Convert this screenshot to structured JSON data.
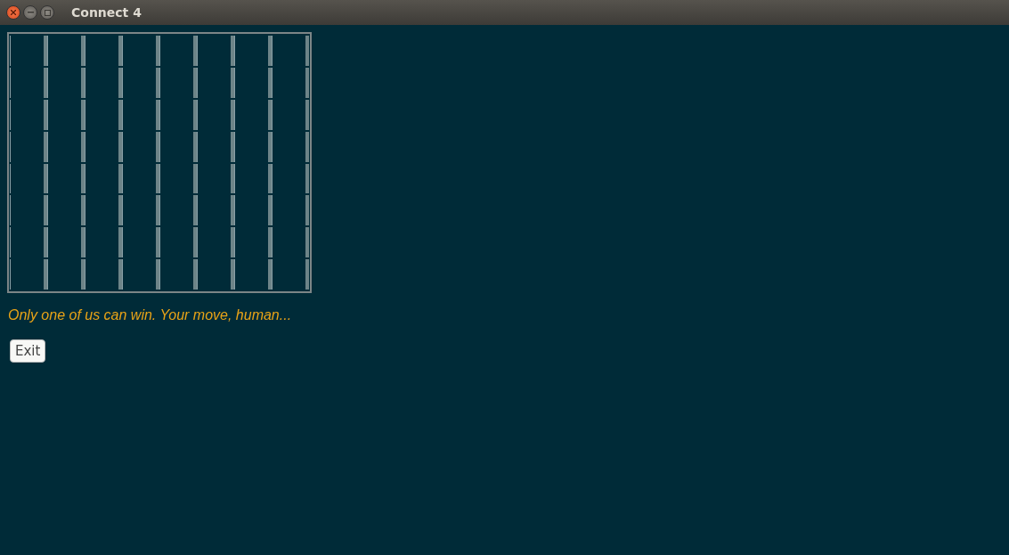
{
  "window": {
    "title": "Connect 4"
  },
  "status_message": "Only one of us can win. Your move, human...",
  "buttons": [
    {
      "label": "Exit"
    }
  ]
}
